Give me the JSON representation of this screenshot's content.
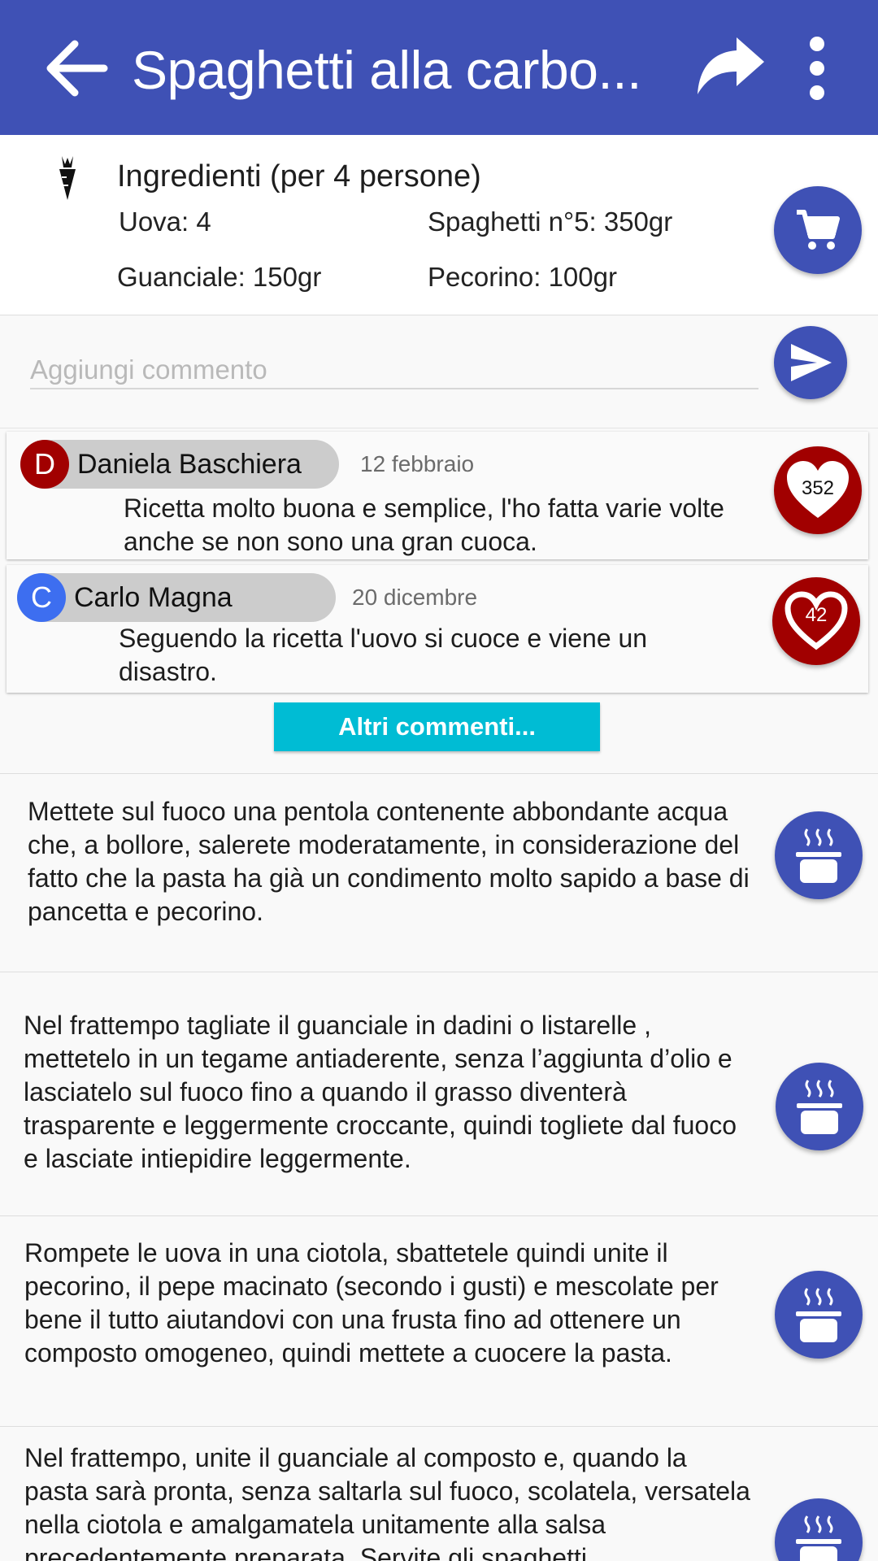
{
  "appbar": {
    "title": "Spaghetti alla carbo...",
    "background": "#3f51b5"
  },
  "ingredients": {
    "title": "Ingredienti (per 4 persone)",
    "items": [
      "Uova: 4",
      "Spaghetti n°5: 350gr",
      "Guanciale: 150gr",
      "Pecorino: 100gr"
    ],
    "icon": "carrot-icon",
    "action_icon": "cart-icon"
  },
  "comment_input": {
    "placeholder": "Aggiungi commento",
    "action_icon": "send-icon"
  },
  "comments": [
    {
      "initial": "D",
      "author": "Daniela Baschiera",
      "date": "12 febbraio",
      "text": "Ricetta molto buona e semplice, l'ho fatta varie volte anche se non sono una gran cuoca.",
      "likes": "352",
      "liked": true,
      "avatar_color": "#a10000"
    },
    {
      "initial": "C",
      "author": "Carlo Magna",
      "date": "20 dicembre",
      "text": "Seguendo la ricetta l'uovo si cuoce e viene un disastro.",
      "likes": "42",
      "liked": false,
      "avatar_color": "#3d6ef0"
    }
  ],
  "more_comments_label": "Altri commenti...",
  "steps": [
    {
      "text": "Mettete sul fuoco una pentola contenente abbondante acqua che, a bollore, salerete moderatamente, in considerazione del fatto che la pasta ha già un condimento molto sapido a base di pancetta e pecorino."
    },
    {
      "text": "Nel frattempo tagliate il guanciale in dadini o listarelle , mettetelo in un tegame antiaderente, senza l’aggiunta d’olio e lasciatelo sul fuoco fino a quando il grasso diventerà trasparente e leggermente croccante, quindi togliete dal fuoco e lasciate intiepidire leggermente."
    },
    {
      "text": "Rompete le uova in una ciotola, sbattetele quindi unite il pecorino, il pepe macinato (secondo i gusti) e mescolate per bene il tutto aiutandovi con una frusta fino ad ottenere un composto omogeneo, quindi mettete a cuocere la pasta."
    },
    {
      "text": "Nel frattempo, unite il guanciale al composto e, quando la pasta sarà pronta, senza saltarla sul fuoco, scolatela, versatela nella ciotola e amalgamatela unitamente alla salsa precedentemente preparata. Servite gli spaghetti"
    }
  ],
  "colors": {
    "primary": "#3f51b5",
    "like": "#a10000",
    "accent": "#00bcd4"
  }
}
